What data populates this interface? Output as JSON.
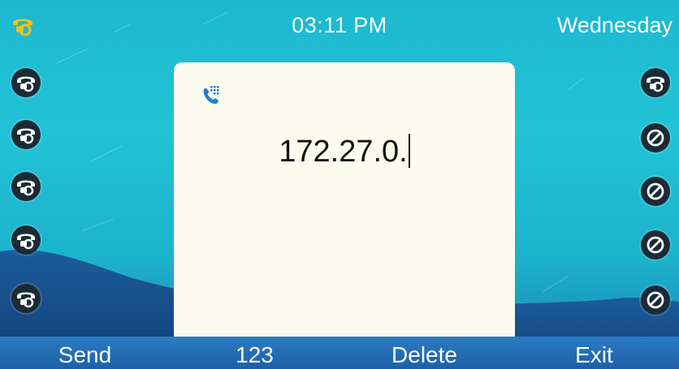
{
  "statusbar": {
    "line_status_icon": "phone-handset-icon",
    "time": "03:11 PM",
    "day": "Wednesday"
  },
  "line_keys": {
    "left": [
      {
        "icon": "phone-handset-icon"
      },
      {
        "icon": "phone-handset-icon"
      },
      {
        "icon": "phone-handset-icon"
      },
      {
        "icon": "phone-handset-icon"
      },
      {
        "icon": "phone-handset-icon"
      }
    ],
    "right": [
      {
        "icon": "phone-handset-icon"
      },
      {
        "icon": "no-entry-icon"
      },
      {
        "icon": "no-entry-icon"
      },
      {
        "icon": "no-entry-icon"
      },
      {
        "icon": "no-entry-icon"
      }
    ]
  },
  "dialog": {
    "icon": "dial-keypad-icon",
    "input_value": "172.27.0."
  },
  "softkeys": [
    {
      "label": "Send"
    },
    {
      "label": "123"
    },
    {
      "label": "Delete"
    },
    {
      "label": "Exit"
    }
  ],
  "colors": {
    "background": "#1db8d0",
    "dialog": "#fbfcee",
    "softkey_bar": "#2a7dc4",
    "status_icon": "#f3c21b",
    "accent_icon": "#1e7fd0"
  }
}
